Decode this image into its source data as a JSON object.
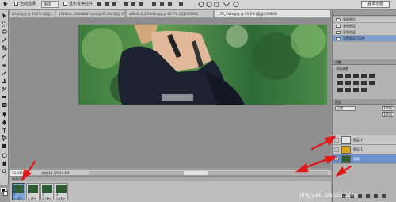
{
  "options_bar": {
    "auto_select_label": "自动选择:",
    "auto_select_value": "图层",
    "show_transform_label": "显示变换控件",
    "essentials_label": "基本功能"
  },
  "tabs": [
    {
      "label": "(10)8.jpg @ 33.3% (图层1...",
      "active": false
    },
    {
      "label": "1216a4c_2d5e8b81.psd @ 25.4% (图层 0/8)",
      "active": false
    },
    {
      "label": "a88e5c3_2d5e8b.jpg @ 66.7% (背景,RGB/8)",
      "active": false
    },
    {
      "label": "...70_5a2e.jpg @ 33.3% (图层0,RGB/8)",
      "active": true
    }
  ],
  "status": {
    "zoom": "33.33%",
    "doc_size": "文档:11.7M/24.6M"
  },
  "animation": {
    "header": "动画(帧)",
    "frames": [
      {
        "num": "1",
        "delay": "0.1秒▾"
      },
      {
        "num": "2",
        "delay": "0.1秒▾"
      },
      {
        "num": "3",
        "delay": "0.1秒▾"
      },
      {
        "num": "4",
        "delay": "0.1秒▾"
      }
    ]
  },
  "history": {
    "items": [
      {
        "label": "复制图层",
        "active": false
      },
      {
        "label": "复制图层",
        "active": false
      },
      {
        "label": "复制图层",
        "active": false
      },
      {
        "label": "设置图层可见性",
        "active": true
      }
    ]
  },
  "actions_panel": {
    "head": "调整",
    "label": "添加调整"
  },
  "layers": {
    "head": "图层",
    "blend_mode": "正常",
    "opacity": "100%",
    "items": [
      {
        "name": "图层 2",
        "active": false,
        "thumb": "#e8e8e8"
      },
      {
        "name": "图层 1",
        "active": false,
        "thumb": "#d9a520"
      },
      {
        "name": "背景",
        "active": true,
        "thumb": "#2e5d35"
      }
    ]
  },
  "watermark": "jingyan.baidu.com",
  "colors": {
    "arrow": "#e01818",
    "selection": "#6e93cc"
  }
}
